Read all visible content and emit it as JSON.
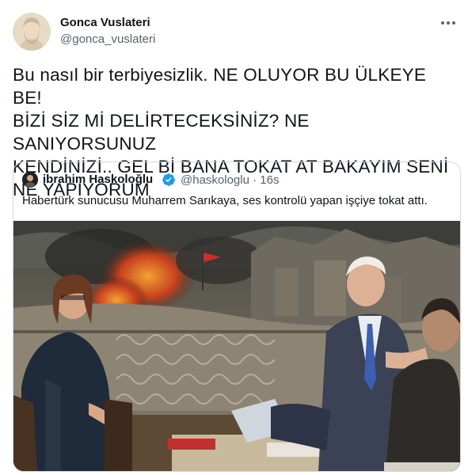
{
  "author": {
    "name": "Gonca Vuslateri",
    "handle": "@gonca_vuslateri"
  },
  "menu_icon": "more-horizontal-icon",
  "tweet": {
    "lines": [
      "Bu nasıl bir terbiyesizlik. NE OLUYOR BU ÜLKEYE BE!",
      "BİZİ SİZ Mİ DELİRTECEKSİNİZ? NE SANIYORSUNUZ",
      "KENDİNİZİ.. GEL Bİ BANA TOKAT AT BAKAYIM SENİ",
      "NE YAPIYORUM"
    ]
  },
  "quoted": {
    "name": "ibrahim Haskoloğlu",
    "verified_icon": "verified-badge-icon",
    "handle_time": "@haskologlu · 16s",
    "text": "Habertürk sunucusu Muharrem Sarıkaya, ses kontrolü yapan işçiye tokat attı.",
    "media": "video-still-studio-scene"
  },
  "colors": {
    "text_primary": "#0f1419",
    "text_secondary": "#536471",
    "border": "#cfd9de",
    "verified": "#1d9bf0"
  }
}
